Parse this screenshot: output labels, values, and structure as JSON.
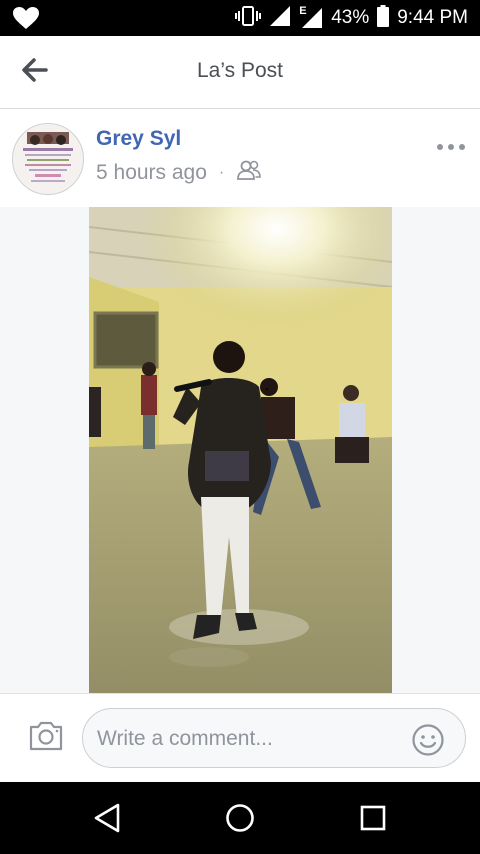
{
  "status_bar": {
    "network": "E",
    "battery_percent": "43%",
    "time": "9:44 PM"
  },
  "header": {
    "title": "La’s Post"
  },
  "post": {
    "author": "Grey Syl",
    "timestamp": "5 hours ago",
    "separator": "·",
    "audience_icon": "friends-icon"
  },
  "comment_bar": {
    "placeholder": "Write a comment..."
  },
  "icons": {
    "notification": "heart-icon",
    "vibrate": "vibrate-icon",
    "back": "arrow-left-icon",
    "more": "more-icon",
    "camera": "camera-icon",
    "emoji": "smiley-icon",
    "nav_back": "triangle-back-icon",
    "nav_home": "circle-home-icon",
    "nav_recents": "square-recents-icon"
  },
  "colors": {
    "brand_link": "#4267b2",
    "meta_text": "#90949c",
    "header_text": "#4b4f56"
  }
}
